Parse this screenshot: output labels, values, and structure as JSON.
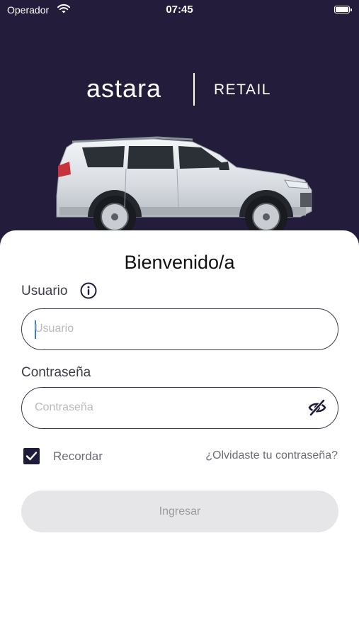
{
  "status_bar": {
    "carrier": "Operador",
    "time": "07:45"
  },
  "brand": {
    "logo": "astara",
    "subtitle": "RETAIL"
  },
  "form": {
    "title": "Bienvenido/a",
    "username_label": "Usuario",
    "username_placeholder": "Usuario",
    "password_label": "Contraseña",
    "password_placeholder": "Contraseña",
    "remember_label": "Recordar",
    "remember_checked": true,
    "forgot_link": "¿Olvidaste tu contraseña?",
    "submit_label": "Ingresar"
  },
  "colors": {
    "header_background": "#231c3a",
    "checkbox_fill": "#1f1b3a",
    "button_disabled": "#e6e6e8"
  },
  "icons": {
    "info": "info-icon",
    "password_visibility": "eye-slash-icon",
    "car": "car-image",
    "wifi": "wifi-icon",
    "battery": "battery-icon",
    "checkbox": "checkmark-icon"
  }
}
